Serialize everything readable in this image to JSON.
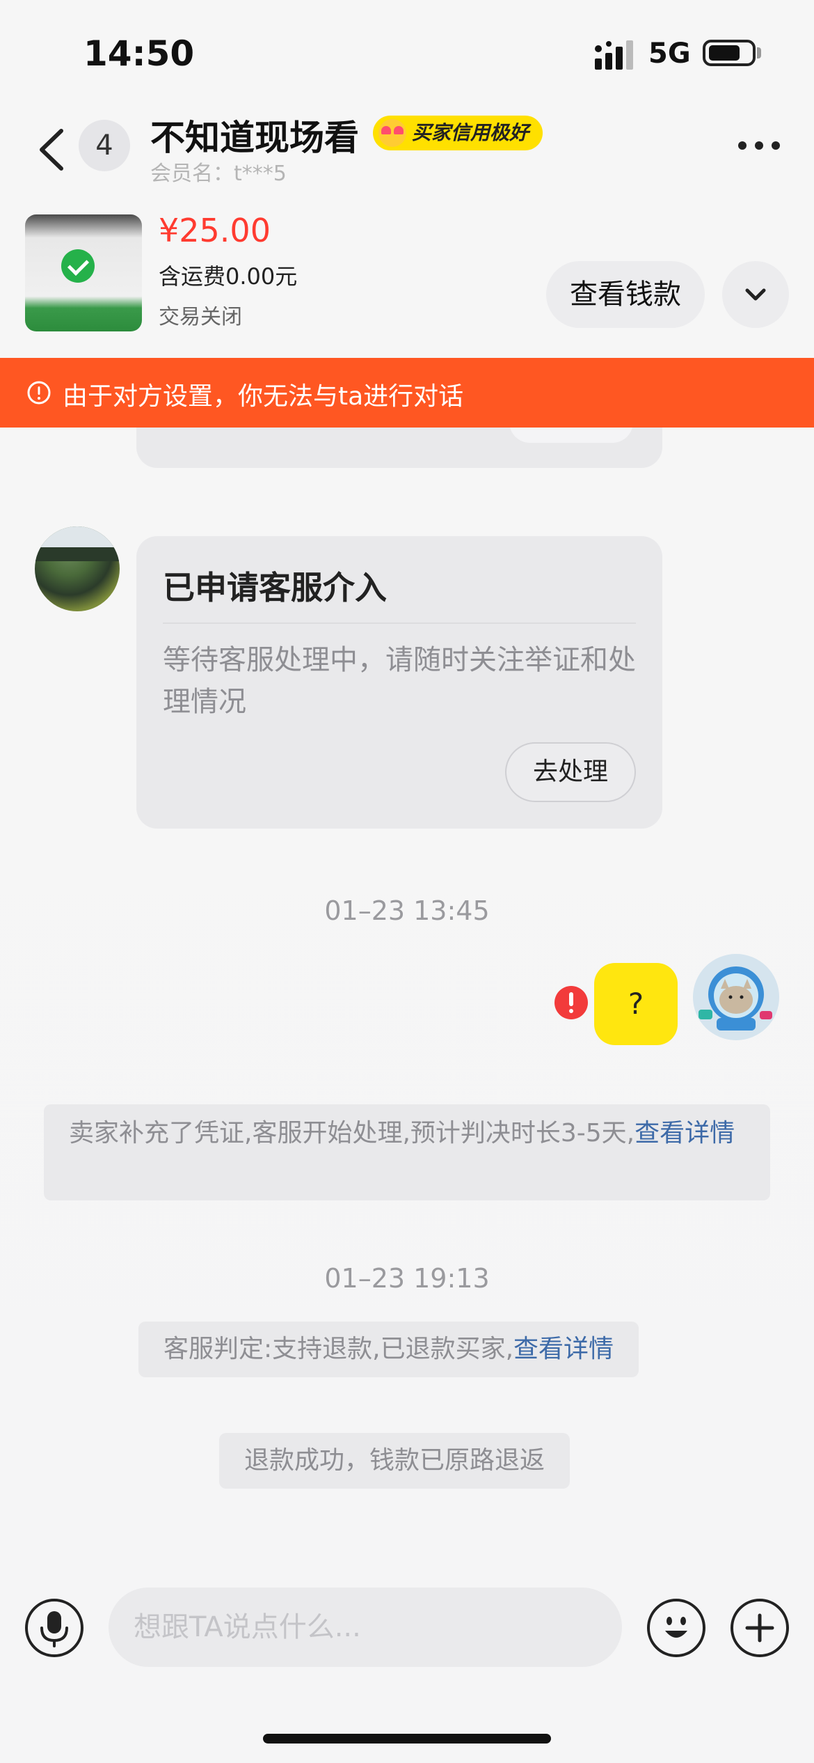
{
  "status_bar": {
    "time": "14:50",
    "network": "5G"
  },
  "header": {
    "unread_count": "4",
    "peer_name": "不知道现场看",
    "credit_badge": "买家信用极好",
    "member_name": "会员名：t***5"
  },
  "product": {
    "price": "¥25.00",
    "shipping": "含运费0.00元",
    "status": "交易关闭",
    "view_funds_label": "查看钱款"
  },
  "warning": {
    "text": "由于对方设置，你无法与ta进行对话"
  },
  "chat": {
    "card": {
      "title": "已申请客服介入",
      "description": "等待客服处理中，请随时关注举证和处理情况",
      "button": "去处理"
    },
    "timestamp_1": "01–23 13:45",
    "my_message": "?",
    "system_msg_1": {
      "text": "卖家补充了凭证,客服开始处理,预计判决时长3-5天,",
      "link": "查看详情"
    },
    "timestamp_2": "01–23 19:13",
    "system_msg_2": {
      "text": "客服判定:支持退款,已退款买家,",
      "link": "查看详情"
    },
    "system_msg_3": {
      "text": "退款成功，钱款已原路退返"
    }
  },
  "input_bar": {
    "placeholder": "想跟TA说点什么..."
  },
  "colors": {
    "accent_orange": "#ff5722",
    "price_red": "#ff3b30",
    "bubble_yellow": "#ffe60f",
    "link_blue": "#3d6aa8",
    "error_red": "#f23b3b"
  },
  "icons": [
    "back-icon",
    "more-icon",
    "chevron-down-icon",
    "warning-icon",
    "error-icon",
    "microphone-icon",
    "emoji-icon",
    "plus-icon"
  ]
}
